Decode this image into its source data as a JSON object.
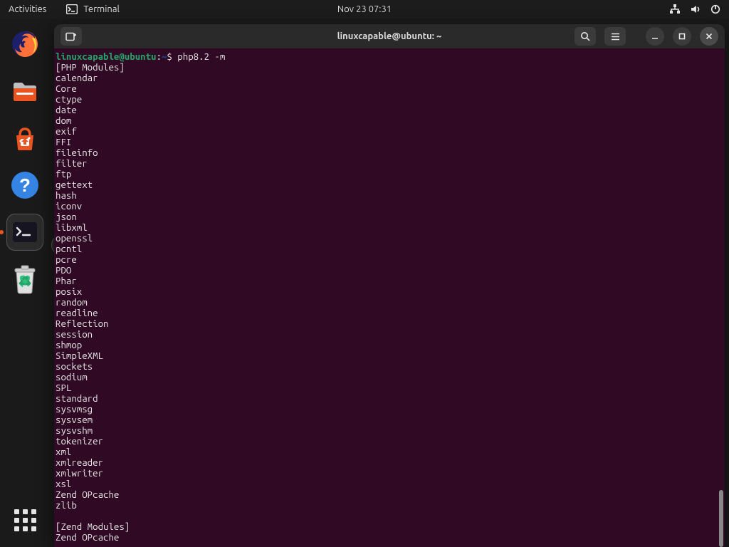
{
  "topbar": {
    "activities": "Activities",
    "app_name": "Terminal",
    "clock": "Nov 23  07:31"
  },
  "dock": {
    "tooltip": "Terminal"
  },
  "window": {
    "title": "linuxcapable@ubuntu: ~"
  },
  "terminal": {
    "prompt_user_host": "linuxcapable@ubuntu",
    "prompt_sep": ":",
    "prompt_path": "~",
    "prompt_symbol": "$",
    "command": "php8.2 -m",
    "output_lines": [
      "[PHP Modules]",
      "calendar",
      "Core",
      "ctype",
      "date",
      "dom",
      "exif",
      "FFI",
      "fileinfo",
      "filter",
      "ftp",
      "gettext",
      "hash",
      "iconv",
      "json",
      "libxml",
      "openssl",
      "pcntl",
      "pcre",
      "PDO",
      "Phar",
      "posix",
      "random",
      "readline",
      "Reflection",
      "session",
      "shmop",
      "SimpleXML",
      "sockets",
      "sodium",
      "SPL",
      "standard",
      "sysvmsg",
      "sysvsem",
      "sysvshm",
      "tokenizer",
      "xml",
      "xmlreader",
      "xmlwriter",
      "xsl",
      "Zend OPcache",
      "zlib",
      "",
      "[Zend Modules]",
      "Zend OPcache"
    ]
  }
}
